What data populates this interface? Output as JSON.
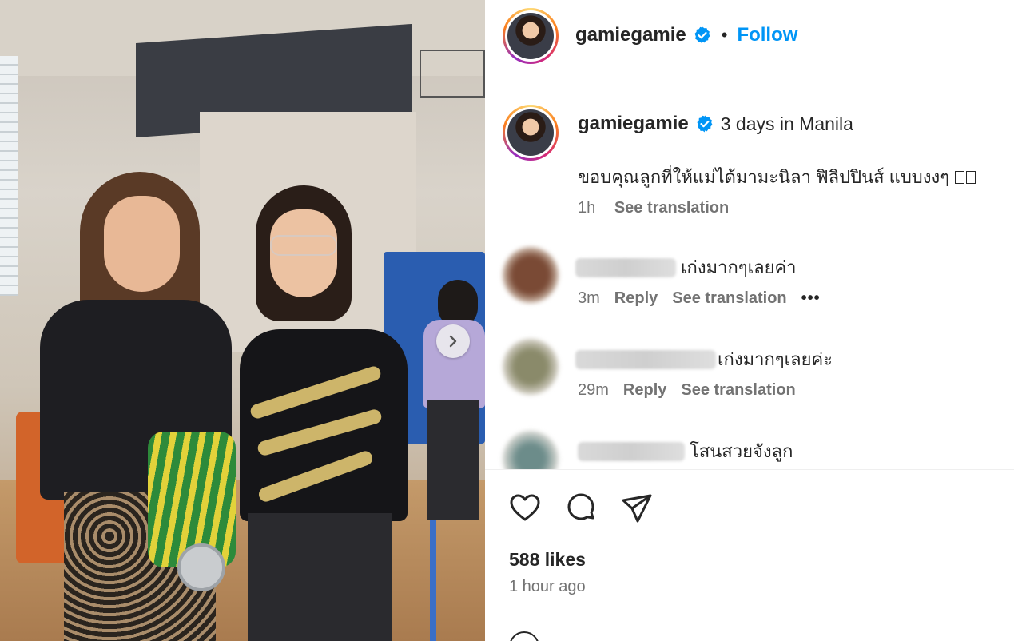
{
  "post": {
    "author": "gamiegamie",
    "follow_label": "Follow",
    "separator": "•",
    "location": "3 days in Manila",
    "caption": "ขอบคุณลูกที่ให้แม่ได้มามะนิลา ฟิลิปปินส์ แบบงงๆ",
    "caption_age": "1h",
    "see_translation": "See translation"
  },
  "comments": [
    {
      "text": "เก่งมากๆเลยค่า",
      "age": "3m",
      "reply_label": "Reply",
      "translation_label": "See translation",
      "more_label": "•••"
    },
    {
      "text": "เก่งมากๆเลยค่ะ",
      "age": "29m",
      "reply_label": "Reply",
      "translation_label": "See translation"
    },
    {
      "text": "โสนสวยจังลูก"
    }
  ],
  "stats": {
    "likes": "588 likes",
    "posted": "1 hour ago"
  },
  "icons": {
    "verified": "verified-badge-icon",
    "like": "heart-icon",
    "comment": "comment-icon",
    "share": "share-icon",
    "next": "chevron-right-icon"
  },
  "colors": {
    "link": "#0095f6",
    "verified": "#0095f6",
    "muted": "#737373",
    "text": "#262626"
  }
}
